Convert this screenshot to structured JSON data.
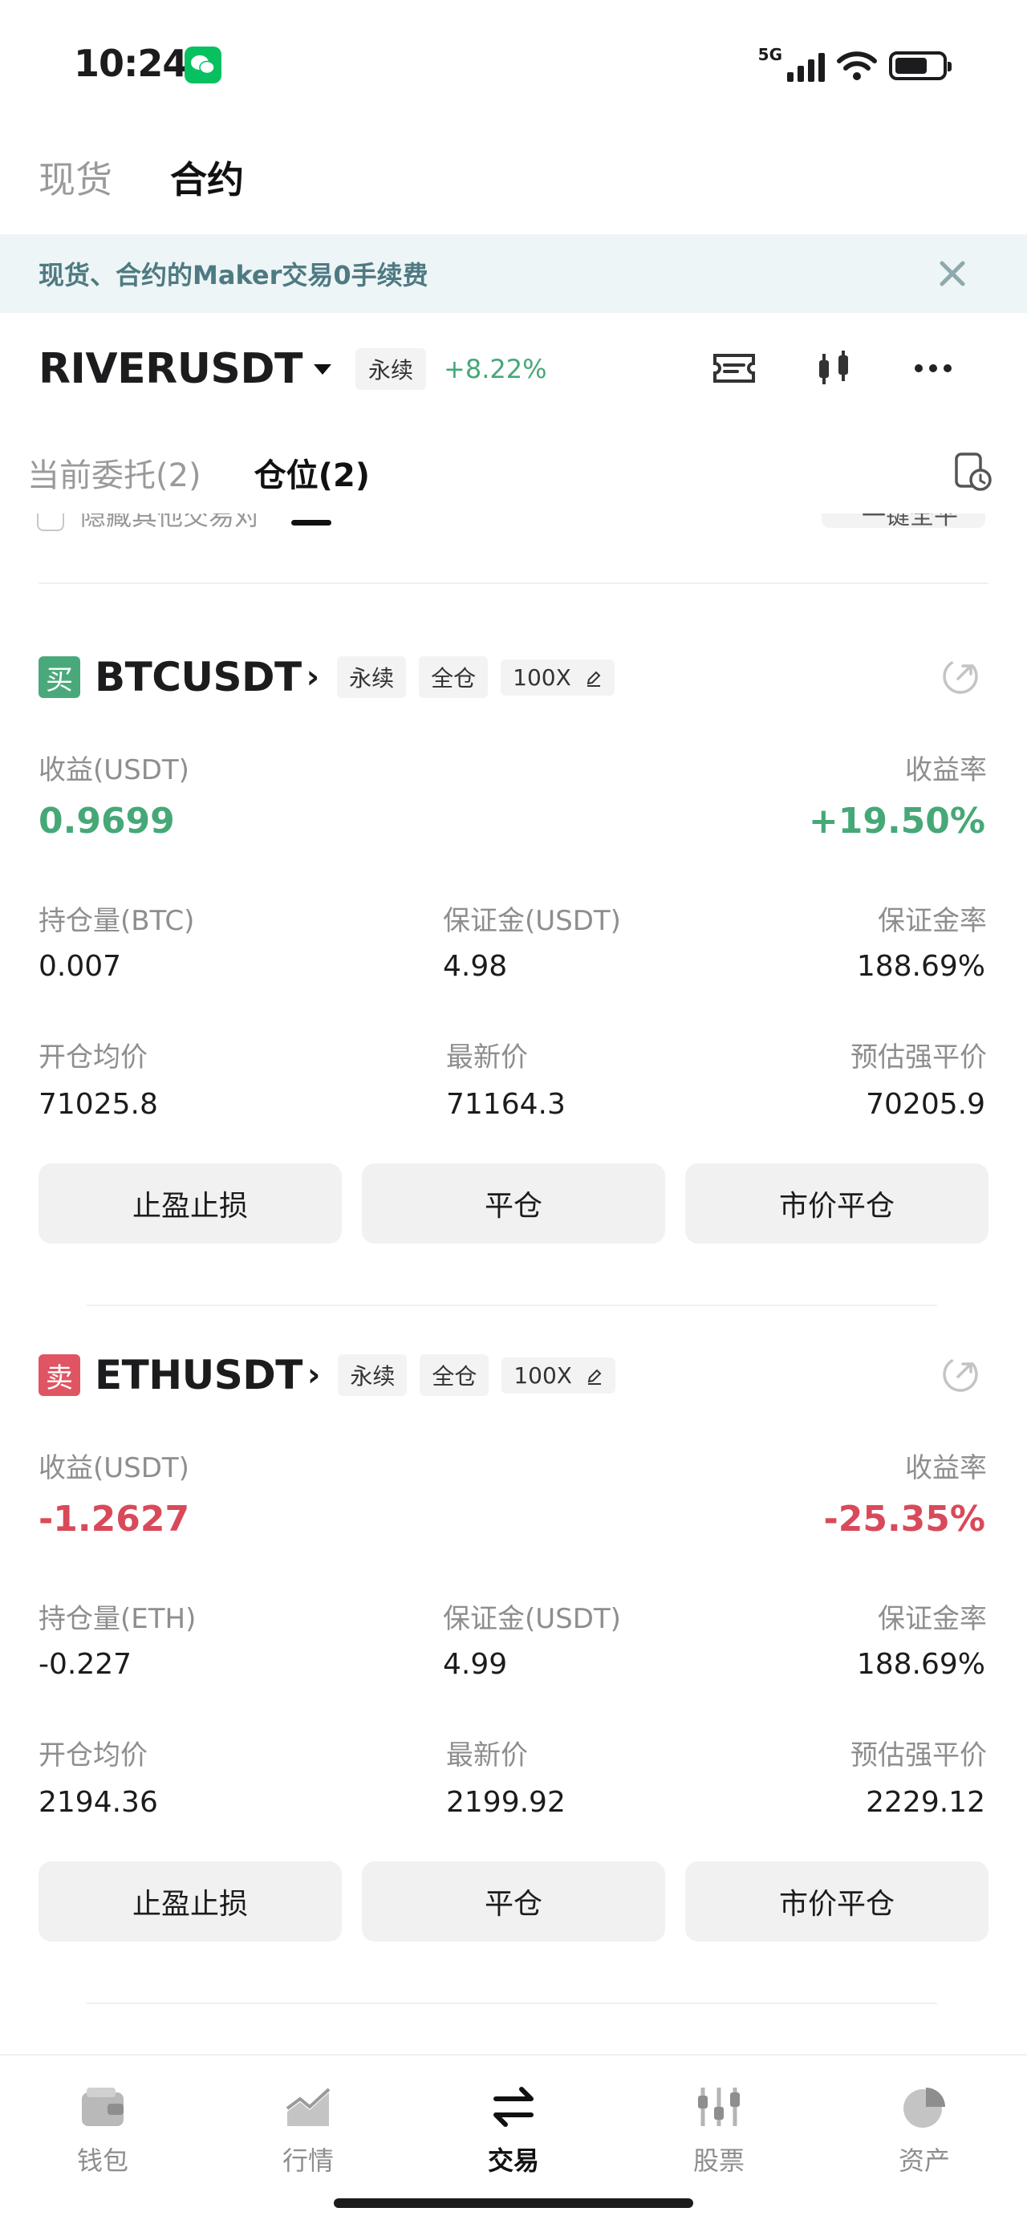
{
  "status_bar": {
    "time": "10:24",
    "network": "5G",
    "battery_level": 0.7
  },
  "top_tabs": [
    "现货",
    "合约"
  ],
  "banner": {
    "text": "现货、合约的Maker交易0手续费"
  },
  "ticker": {
    "symbol": "RIVERUSDT",
    "tag": "永续",
    "change": "+8.22%"
  },
  "position_tabs": [
    "当前委托(2)",
    "仓位(2)"
  ],
  "partial_row": {
    "checkbox_label": "隐藏其他交易对",
    "button_label": "一键全平"
  },
  "labels": {
    "pnl": "收益(USDT)",
    "roe": "收益率",
    "margin": "保证金(USDT)",
    "margin_ratio": "保证金率",
    "entry_price": "开仓均价",
    "last_price": "最新价",
    "liq_price": "预估强平价"
  },
  "positions": [
    {
      "side": "买",
      "pair": "BTCUSDT",
      "type": "永续",
      "margin_mode": "全仓",
      "leverage": "100X",
      "pnl": "0.9699",
      "roe": "+19.50%",
      "size_label": "持仓量(BTC)",
      "size": "0.007",
      "margin": "4.98",
      "margin_ratio": "188.69%",
      "entry_price": "71025.8",
      "last_price": "71164.3",
      "liq_price": "70205.9"
    },
    {
      "side": "卖",
      "pair": "ETHUSDT",
      "type": "永续",
      "margin_mode": "全仓",
      "leverage": "100X",
      "pnl": "-1.2627",
      "roe": "-25.35%",
      "size_label": "持仓量(ETH)",
      "size": "-0.227",
      "margin": "4.99",
      "margin_ratio": "188.69%",
      "entry_price": "2194.36",
      "last_price": "2199.92",
      "liq_price": "2229.12"
    }
  ],
  "buttons": {
    "tpsl": "止盈止损",
    "close": "平仓",
    "market_close": "市价平仓"
  },
  "bottom_nav": [
    {
      "label": "钱包",
      "icon": "wallet-icon"
    },
    {
      "label": "行情",
      "icon": "market-chart-icon"
    },
    {
      "label": "交易",
      "icon": "swap-arrows-icon"
    },
    {
      "label": "股票",
      "icon": "stock-sliders-icon"
    },
    {
      "label": "资产",
      "icon": "pie-chart-icon"
    }
  ],
  "colors": {
    "green": "#46a877",
    "red": "#d84a5a",
    "accent_bg": "#eef5f6"
  }
}
